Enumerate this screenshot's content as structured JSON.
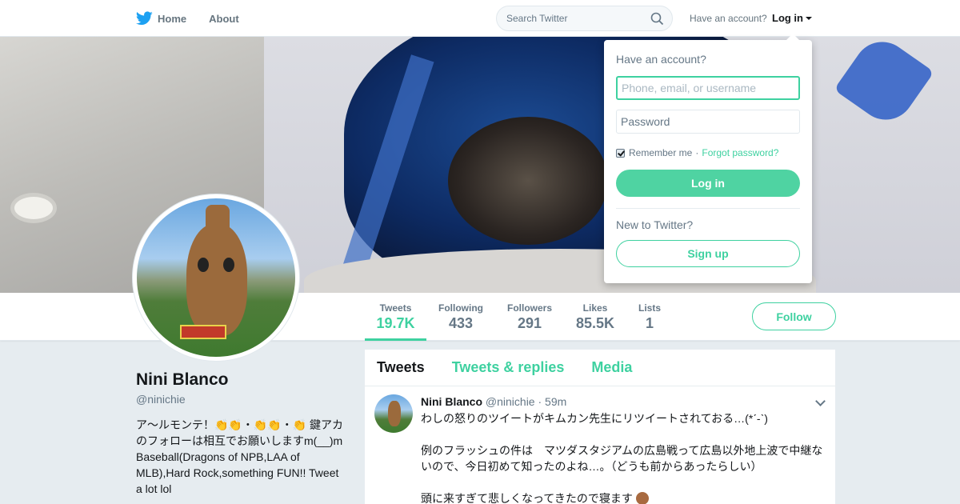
{
  "nav": {
    "home_label": "Home",
    "about_label": "About",
    "search_placeholder": "Search Twitter",
    "have_account": "Have an account?",
    "login_label": "Log in"
  },
  "login_dropdown": {
    "title": "Have an account?",
    "username_placeholder": "Phone, email, or username",
    "password_placeholder": "Password",
    "remember_label": "Remember me",
    "separator": "·",
    "forgot_label": "Forgot password?",
    "login_button": "Log in",
    "new_prompt": "New to Twitter?",
    "signup_button": "Sign up"
  },
  "profile": {
    "name": "Nini Blanco",
    "handle": "@ninichie",
    "bio": "ア～ルモンテ！👏👏・👏👏・👏 鍵アカのフォローは相互でお願いしますm(__)m Baseball(Dragons of NPB,LAA of MLB),Hard Rock,something FUN!! Tweet a lot lol"
  },
  "stats": [
    {
      "label": "Tweets",
      "value": "19.7K"
    },
    {
      "label": "Following",
      "value": "433"
    },
    {
      "label": "Followers",
      "value": "291"
    },
    {
      "label": "Likes",
      "value": "85.5K"
    },
    {
      "label": "Lists",
      "value": "1"
    }
  ],
  "follow_button": "Follow",
  "timeline": {
    "tabs": [
      "Tweets",
      "Tweets & replies",
      "Media"
    ],
    "tweet": {
      "name": "Nini Blanco",
      "handle": "@ninichie",
      "dot": "·",
      "time": "59m",
      "line1": "わしの怒りのツイートがキムカン先生にリツイートされておる…(*ˊ-ˋ)",
      "line2": "例のフラッシュの件は　マツダスタジアムの広島戦って広島以外地上波で中継ないので、今日初めて知ったのよね…。（どうも前からあったらしい）",
      "line3": "頭に来すぎて悲しくなってきたので寝ます"
    }
  },
  "colors": {
    "accent": "#3ed1a0",
    "twitter_blue": "#1da1f2"
  }
}
